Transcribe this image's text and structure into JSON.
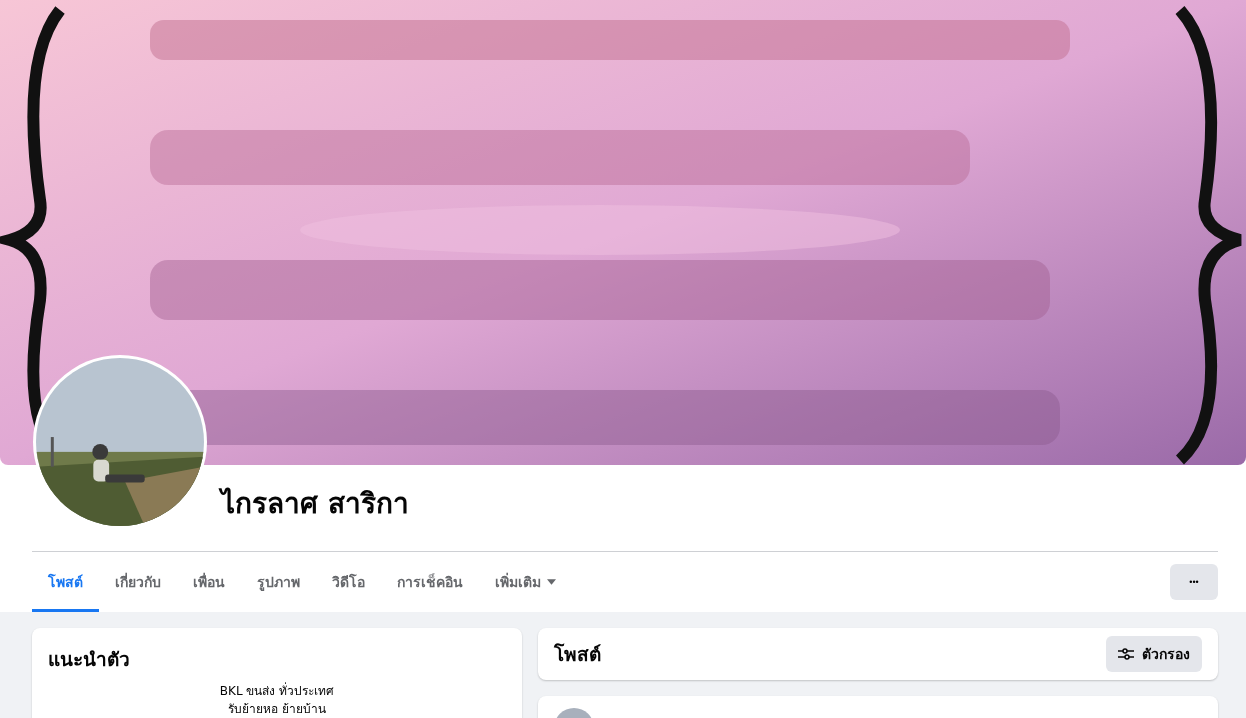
{
  "profile": {
    "name": "ไกรลาศ สาริกา"
  },
  "tabs": [
    {
      "label": "โพสต์",
      "selected": true
    },
    {
      "label": "เกี่ยวกับ",
      "selected": false
    },
    {
      "label": "เพื่อน",
      "selected": false
    },
    {
      "label": "รูปภาพ",
      "selected": false
    },
    {
      "label": "วิดีโอ",
      "selected": false
    },
    {
      "label": "การเช็คอิน",
      "selected": false
    },
    {
      "label": "เพิ่มเติม",
      "selected": false,
      "dropdown": true
    }
  ],
  "more_button": "•••",
  "intro": {
    "title": "แนะนำตัว",
    "bio": [
      "BKL ขนส่ง ทั่วประเทศ",
      "รับย้ายหอ ย้ายบ้าน"
    ]
  },
  "posts_header": {
    "title": "โพสต์",
    "filter_button": "ตัวกรอง"
  }
}
